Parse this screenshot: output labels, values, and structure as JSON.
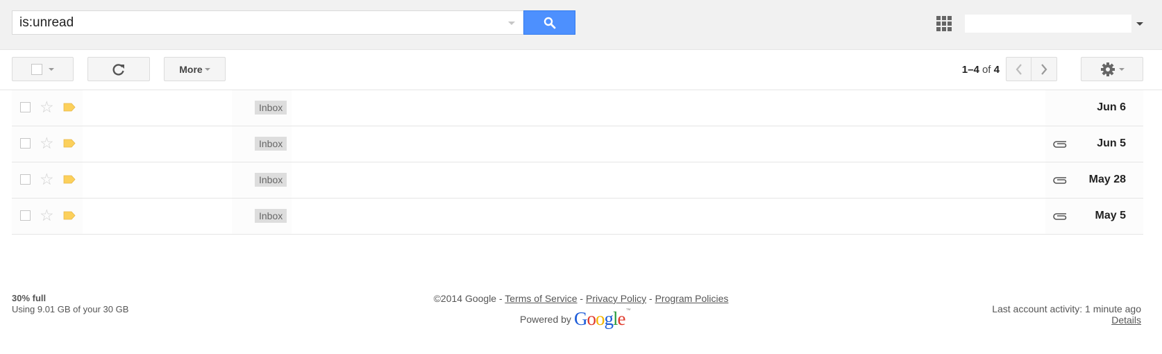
{
  "header": {
    "search_value": "is:unread",
    "search_button_icon": "search-icon",
    "apps_icon": "apps-grid-icon",
    "account_name": "",
    "account_dropdown_icon": "chevron-down-icon"
  },
  "toolbar": {
    "select_icon": "checkbox-icon",
    "refresh_icon": "refresh-icon",
    "more_label": "More",
    "pager": {
      "range": "1–4",
      "of": "of",
      "total": "4"
    },
    "prev_icon": "chevron-left-icon",
    "next_icon": "chevron-right-icon",
    "settings_icon": "gear-icon"
  },
  "messages": [
    {
      "label": "Inbox",
      "attachment": false,
      "date": "Jun 6"
    },
    {
      "label": "Inbox",
      "attachment": true,
      "date": "Jun 5"
    },
    {
      "label": "Inbox",
      "attachment": true,
      "date": "May 28"
    },
    {
      "label": "Inbox",
      "attachment": true,
      "date": "May 5"
    }
  ],
  "footer": {
    "storage_percent": "30% full",
    "storage_detail": "Using 9.01 GB of your 30 GB",
    "copyright": "©2014 Google -",
    "terms": "Terms of Service",
    "sep": "-",
    "privacy": "Privacy Policy",
    "program": "Program Policies",
    "powered_by": "Powered by",
    "logo_letters": [
      "G",
      "o",
      "o",
      "g",
      "l",
      "e"
    ],
    "logo_colors": [
      "#1a5ad8",
      "#e03a2c",
      "#f4b400",
      "#1a5ad8",
      "#2a9b3f",
      "#e03a2c"
    ],
    "tm": "™",
    "last_activity": "Last account activity: 1 minute ago",
    "details": "Details"
  },
  "colors": {
    "accent": "#4d90fe",
    "important_marker": "#fcd05b"
  }
}
